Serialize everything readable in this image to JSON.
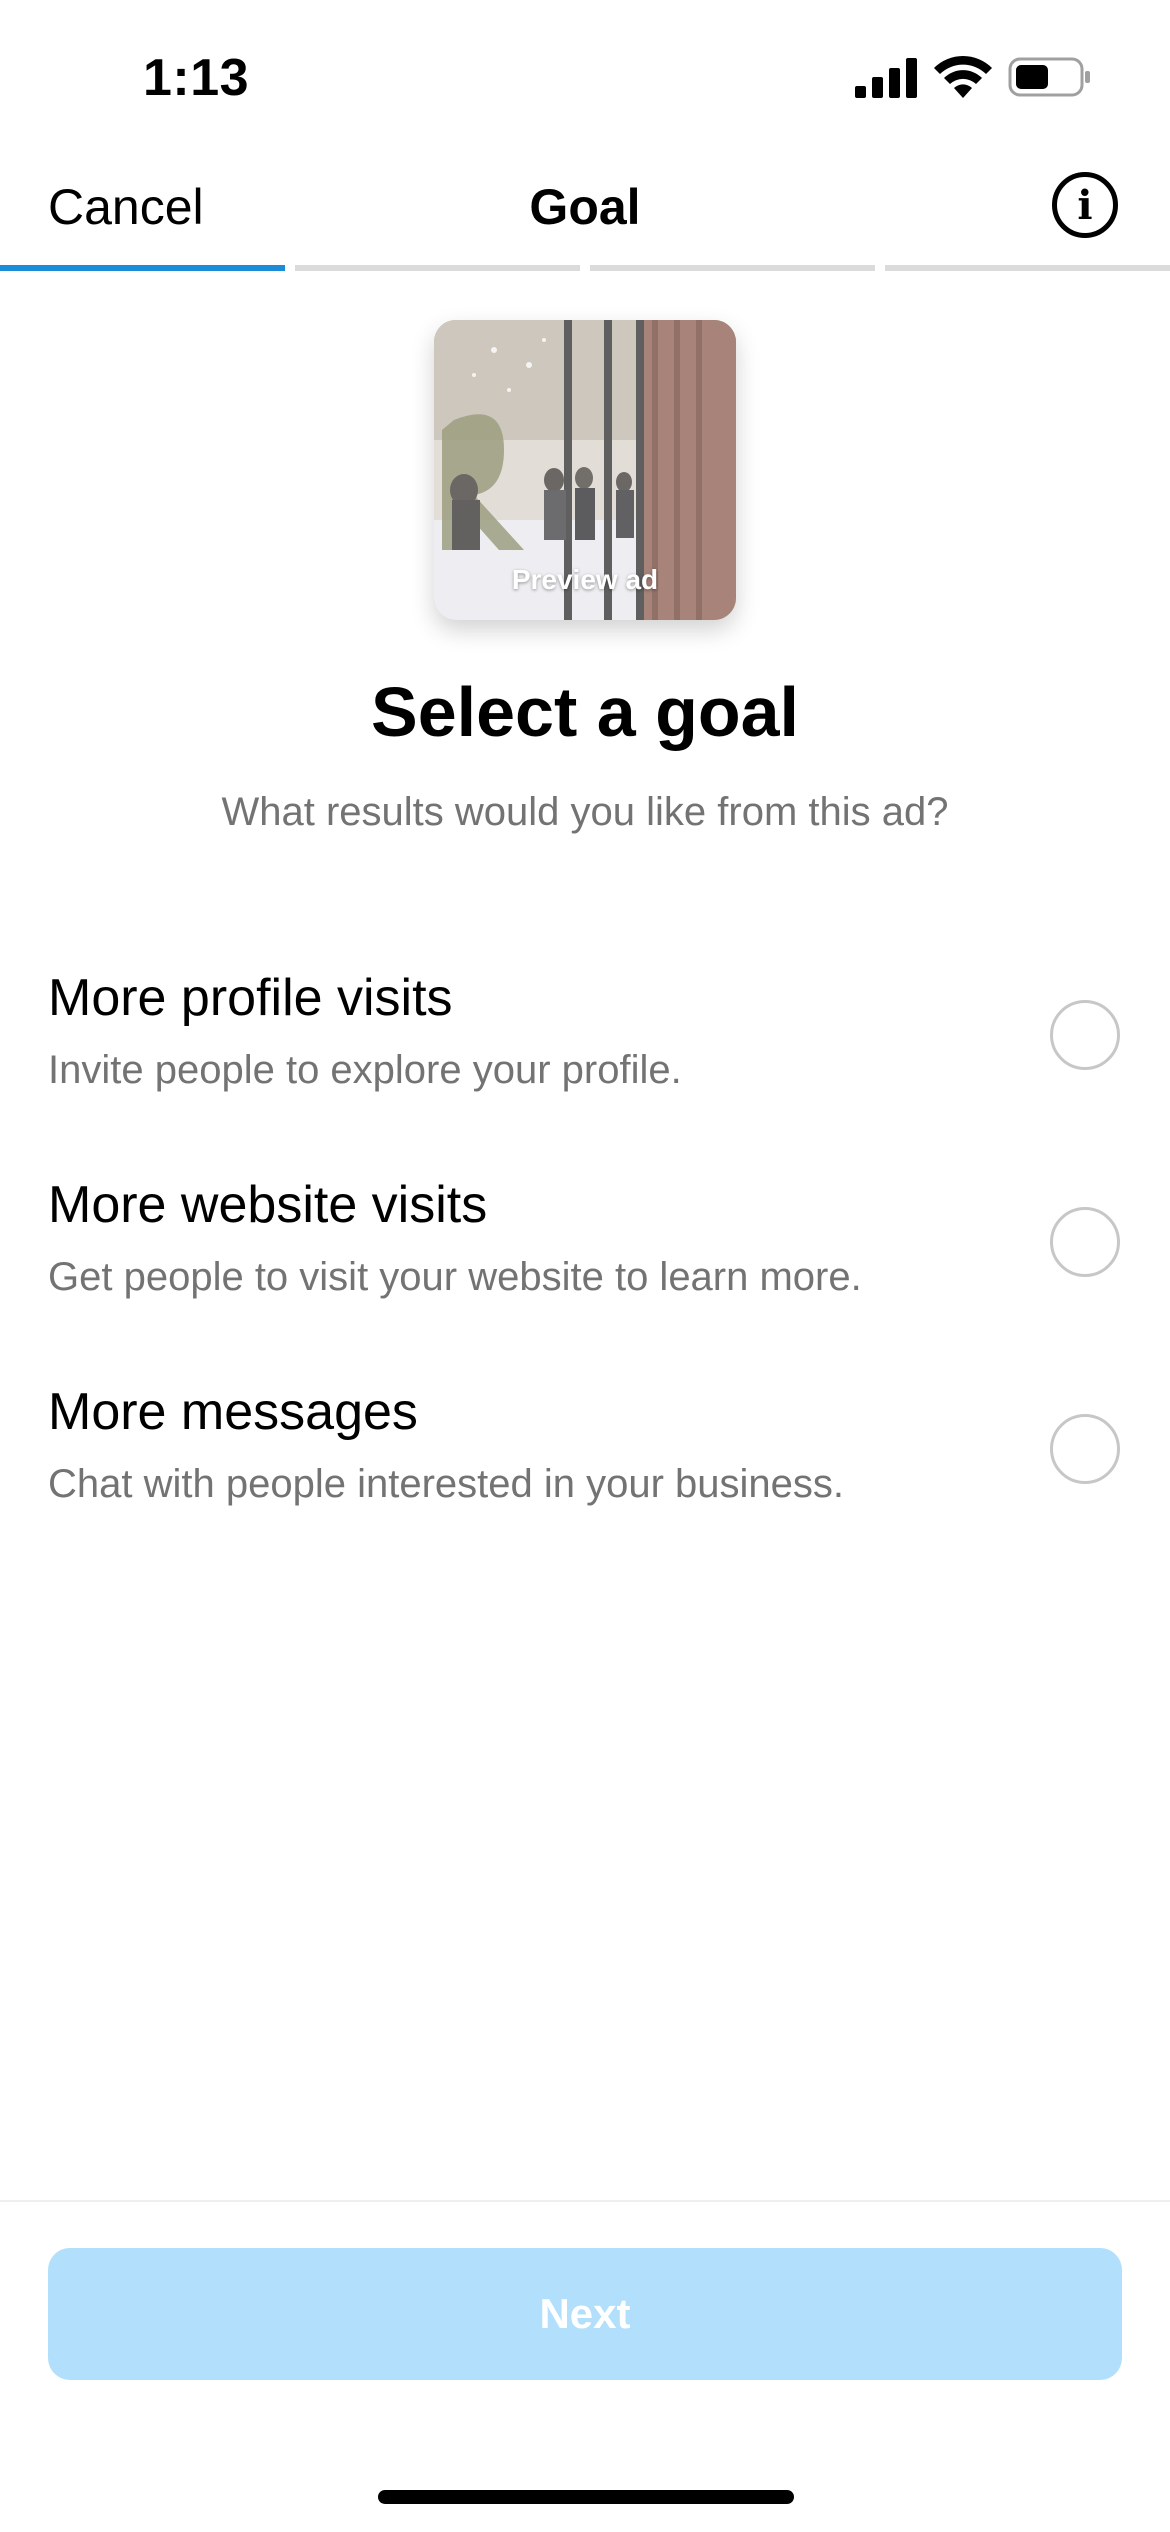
{
  "status_bar": {
    "time": "1:13"
  },
  "header": {
    "cancel_label": "Cancel",
    "title": "Goal",
    "info_icon_glyph": "i"
  },
  "progress": {
    "total_steps": 4,
    "current_step": 1
  },
  "preview": {
    "label": "Preview ad"
  },
  "main": {
    "title": "Select a goal",
    "subtitle": "What results would you like from this ad?"
  },
  "options": [
    {
      "title": "More profile visits",
      "description": "Invite people to explore your profile.",
      "selected": false
    },
    {
      "title": "More website visits",
      "description": "Get people to visit your website to learn more.",
      "selected": false
    },
    {
      "title": "More messages",
      "description": "Chat with people interested in your business.",
      "selected": false
    }
  ],
  "footer": {
    "next_label": "Next"
  },
  "colors": {
    "accent": "#1a8cd8",
    "next_disabled": "#b2dffc",
    "secondary_text": "#737373"
  }
}
